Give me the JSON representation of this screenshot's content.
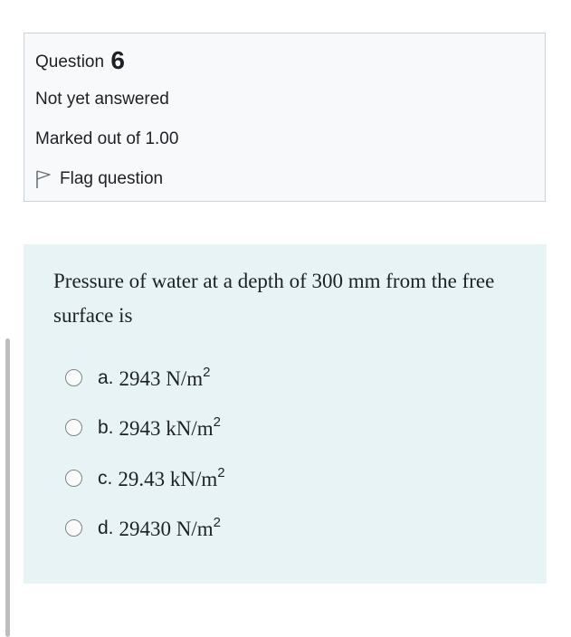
{
  "info": {
    "question_label": "Question",
    "question_number": "6",
    "state": "Not yet answered",
    "grade": "Marked out of 1.00",
    "flag_label": "Flag question"
  },
  "question": {
    "text": "Pressure of water at a depth of 300 mm from the free surface is",
    "options": [
      {
        "letter": "a.",
        "value": "2943 N/m",
        "sup": "2"
      },
      {
        "letter": "b.",
        "value": "2943 kN/m",
        "sup": "2"
      },
      {
        "letter": "c.",
        "value": "29.43 kN/m",
        "sup": "2"
      },
      {
        "letter": "d.",
        "value": "29430 N/m",
        "sup": "2"
      }
    ]
  },
  "colors": {
    "info_background": "#f8f9fa",
    "formulation_background": "#e7f3f5",
    "border": "#cdd1d6"
  },
  "icons": {
    "flag": "flag-outline-icon",
    "radio": "radio-unchecked-icon"
  }
}
